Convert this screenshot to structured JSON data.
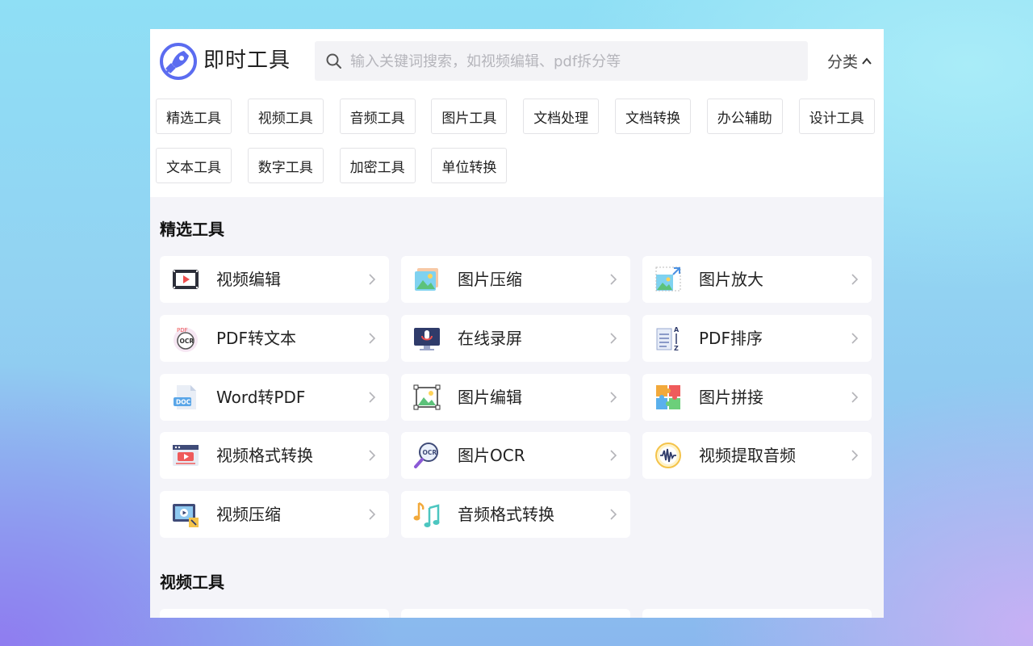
{
  "brand": {
    "name": "即时工具",
    "logo_icon": "rocket-icon",
    "accent": "#5b6cf0"
  },
  "search": {
    "placeholder": "输入关键词搜索，如视频编辑、pdf拆分等",
    "value": ""
  },
  "category_toggle": {
    "label": "分类",
    "icon": "chevron-up-icon"
  },
  "categories": [
    "精选工具",
    "视频工具",
    "音频工具",
    "图片工具",
    "文档处理",
    "文档转换",
    "办公辅助",
    "设计工具",
    "文本工具",
    "数字工具",
    "加密工具",
    "单位转换"
  ],
  "featured": {
    "title": "精选工具",
    "tools": [
      {
        "label": "视频编辑",
        "icon": "video-edit-icon"
      },
      {
        "label": "图片压缩",
        "icon": "image-compress-icon"
      },
      {
        "label": "图片放大",
        "icon": "image-enlarge-icon"
      },
      {
        "label": "PDF转文本",
        "icon": "pdf-ocr-icon"
      },
      {
        "label": "在线录屏",
        "icon": "screen-record-icon"
      },
      {
        "label": "PDF排序",
        "icon": "pdf-sort-icon"
      },
      {
        "label": "Word转PDF",
        "icon": "doc-file-icon"
      },
      {
        "label": "图片编辑",
        "icon": "image-edit-icon"
      },
      {
        "label": "图片拼接",
        "icon": "puzzle-icon"
      },
      {
        "label": "视频格式转换",
        "icon": "video-convert-icon"
      },
      {
        "label": "图片OCR",
        "icon": "ocr-magnifier-icon"
      },
      {
        "label": "视频提取音频",
        "icon": "audio-wave-icon"
      },
      {
        "label": "视频压缩",
        "icon": "video-compress-icon"
      },
      {
        "label": "音频格式转换",
        "icon": "music-notes-icon"
      }
    ]
  },
  "video_section": {
    "title": "视频工具"
  }
}
